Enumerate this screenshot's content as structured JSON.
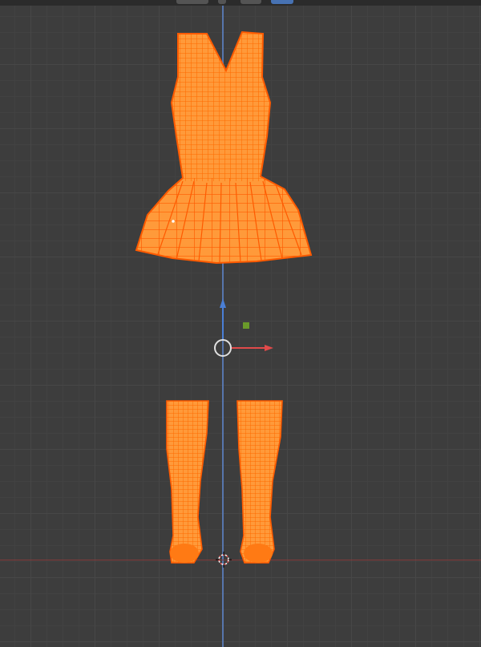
{
  "viewport": {
    "view": "front-orthographic",
    "background_color": "#3d3d3d",
    "grid_color": "#474747",
    "selection_color": "#ff7f0e",
    "wire_color": "#ff5a00"
  },
  "header": {
    "mode_label": "",
    "pivot_icon": "pivot-icon",
    "snap_icon": "snap-icon",
    "proportional_icon": "proportional-edit-icon"
  },
  "objects": [
    {
      "name": "dress",
      "selected": true,
      "display": "wireframe"
    },
    {
      "name": "sock-left",
      "selected": true,
      "display": "wireframe"
    },
    {
      "name": "sock-right",
      "selected": true,
      "display": "wireframe"
    }
  ],
  "gizmo": {
    "type": "move",
    "x_axis_color": "#e04a4a",
    "z_axis_color": "#4a7fd6",
    "plane_handle_color": "#6a9a2a"
  },
  "cursor_3d": {
    "icon": "3d-cursor-icon"
  }
}
